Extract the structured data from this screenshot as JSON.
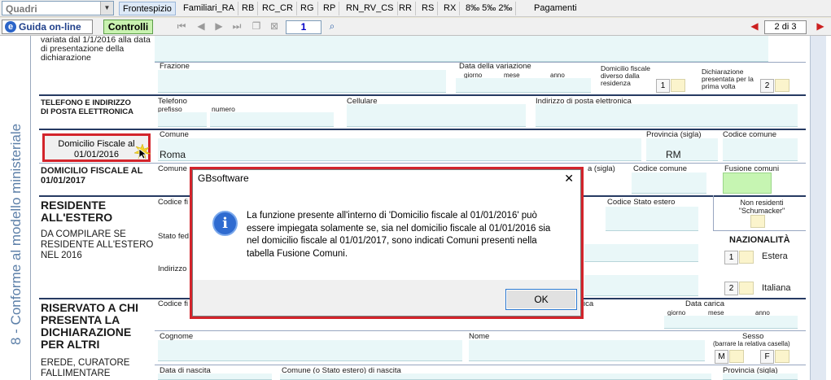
{
  "toolbar": {
    "combo_value": "Quadri",
    "tabs": [
      {
        "label": "Frontespizio",
        "active": true
      },
      {
        "label": "Familiari_RA"
      },
      {
        "label": "RB"
      },
      {
        "label": "RC_CR"
      },
      {
        "label": "RG"
      },
      {
        "label": "RP"
      },
      {
        "label": "RN_RV_CS"
      },
      {
        "label": "RR"
      },
      {
        "label": "RS"
      },
      {
        "label": "RX"
      },
      {
        "label": "8‰ 5‰ 2‰"
      },
      {
        "label": "Pagamenti"
      }
    ]
  },
  "toolbar2": {
    "guida_label": "Guida on-line",
    "controlli_label": "Controlli",
    "page_number": "1",
    "page_of": "2 di 3"
  },
  "sidebar": {
    "vertical_text": "8 - Conforme al modello ministeriale"
  },
  "form": {
    "top_label": "variata dal 1/1/2016 alla data di presentazione della dichiarazione",
    "frazione": "Frazione",
    "data_variazione": "Data della variazione",
    "giorno": "giorno",
    "mese": "mese",
    "anno": "anno",
    "domicilio_diverso": "Domicilio fiscale diverso dalla residenza",
    "dom_box": "1",
    "dichiarazione_presentata": "Dichiarazione presentata per la prima volta",
    "dich_box": "2",
    "tel_section": "TELEFONO E INDIRIZZO DI POSTA ELETTRONICA",
    "telefono": "Telefono",
    "prefisso": "prefisso",
    "numero": "numero",
    "cellulare": "Cellulare",
    "email": "Indirizzo di posta elettronica",
    "comune": "Comune",
    "provincia_sigla": "Provincia (sigla)",
    "codice_comune": "Codice comune",
    "df_button": "Domicilio Fiscale al 01/01/2016",
    "comune_value": "Roma",
    "provincia_value": "RM",
    "df2017_title": "DOMICILIO FISCALE AL 01/01/2017",
    "df2017_comune": "Comune",
    "df2017_prov": "a (sigla)",
    "df2017_codice": "Codice comune",
    "fusione": "Fusione comuni",
    "res_estero_title": "RESIDENTE ALL'ESTERO",
    "res_estero_sub": "DA COMPILARE SE RESIDENTE ALL'ESTERO NEL 2016",
    "codice_fiscale_partial": "Codice fi",
    "stato_federato_partial": "Stato fed",
    "indirizzo_partial": "Indirizzo",
    "codice_stato_estero": "Codice Stato estero",
    "non_residenti": "Non residenti \"Schumacker\"",
    "nazionalita": "NAZIONALITÀ",
    "estera_box": "1",
    "estera": "Estera",
    "italiana_box": "2",
    "italiana": "Italiana",
    "riservato_title": "RISERVATO A CHI PRESENTA LA DICHIARAZIONE PER ALTRI",
    "eredi": "EREDE, CURATORE FALLIMENTARE",
    "codice_fiscale2_partial": "Codice fi",
    "carica_partial": "ica",
    "data_carica": "Data carica",
    "cognome": "Cognome",
    "nome": "Nome",
    "sesso": "Sesso",
    "sesso_hint": "(barrare la relativa casella)",
    "m": "M",
    "f": "F",
    "data_nascita": "Data di nascita",
    "comune_nascita": "Comune (o Stato estero) di nascita",
    "provincia_sigla2": "Provincia (sigla)"
  },
  "dialog": {
    "title": "GBsoftware",
    "close": "✕",
    "message": "La funzione presente all'interno di 'Domicilio fiscale al 01/01/2016' può essere impiegata solamente se, sia nel domicilio fiscale al 01/01/2016 sia nel domicilio fiscale al 01/01/2017, sono indicati Comuni presenti nella tabella Fusione Comuni.",
    "ok_label": "OK"
  }
}
